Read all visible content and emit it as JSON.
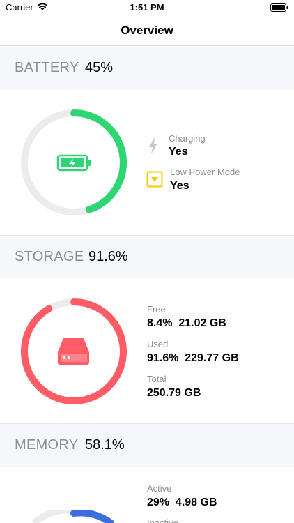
{
  "status_bar": {
    "carrier": "Carrier",
    "time": "1:51 PM"
  },
  "nav": {
    "title": "Overview"
  },
  "battery": {
    "header_label": "BATTERY",
    "header_value": "45%",
    "level": 0.45,
    "color": "#2ed573",
    "charging_label": "Charging",
    "charging_value": "Yes",
    "low_power_label": "Low Power Mode",
    "low_power_value": "Yes"
  },
  "storage": {
    "header_label": "STORAGE",
    "header_value": "91.6%",
    "level": 0.916,
    "color": "#ff5c66",
    "free_label": "Free",
    "free_value": "8.4%  21.02 GB",
    "used_label": "Used",
    "used_value": "91.6%  229.77 GB",
    "total_label": "Total",
    "total_value": "250.79 GB"
  },
  "memory": {
    "header_label": "MEMORY",
    "header_value": "58.1%",
    "color": "#3b6fe0",
    "active_label": "Active",
    "active_value": "29%  4.98 GB",
    "inactive_label": "Inactive"
  },
  "colors": {
    "ring_track": "#ececef",
    "low_power_yellow": "#f5c800",
    "header_bg": "#f5f7fb"
  }
}
